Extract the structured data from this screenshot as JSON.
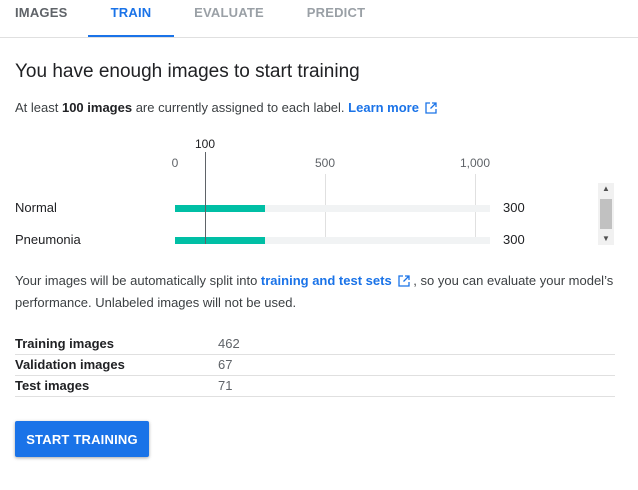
{
  "tabs": [
    {
      "label": "IMAGES"
    },
    {
      "label": "TRAIN"
    },
    {
      "label": "EVALUATE"
    },
    {
      "label": "PREDICT"
    }
  ],
  "active_tab": "TRAIN",
  "heading": "You have enough images to start training",
  "summary": {
    "prefix": "At least ",
    "bold": "100 images",
    "suffix": " are currently assigned to each label.",
    "link": "Learn more"
  },
  "chart": {
    "reference_label": "100",
    "reference_value": 100,
    "axis_max": 1050,
    "ticks": [
      "0",
      "500",
      "1,000"
    ],
    "rows": [
      {
        "label": "Normal",
        "value": 300,
        "value_text": "300"
      },
      {
        "label": "Pneumonia",
        "value": 300,
        "value_text": "300"
      }
    ]
  },
  "split": {
    "before": "Your images will be automatically split into ",
    "link": "training and test sets",
    "after": " , so you can evaluate your model’s performance. Unlabeled images will not be used."
  },
  "stats": [
    {
      "label": "Training images",
      "value": "462"
    },
    {
      "label": "Validation images",
      "value": "67"
    },
    {
      "label": "Test images",
      "value": "71"
    }
  ],
  "start_button": "START TRAINING",
  "colors": {
    "accent": "#1a73e8",
    "bar": "#00bfa5"
  },
  "icons": {
    "external": "open-in-new-icon"
  }
}
